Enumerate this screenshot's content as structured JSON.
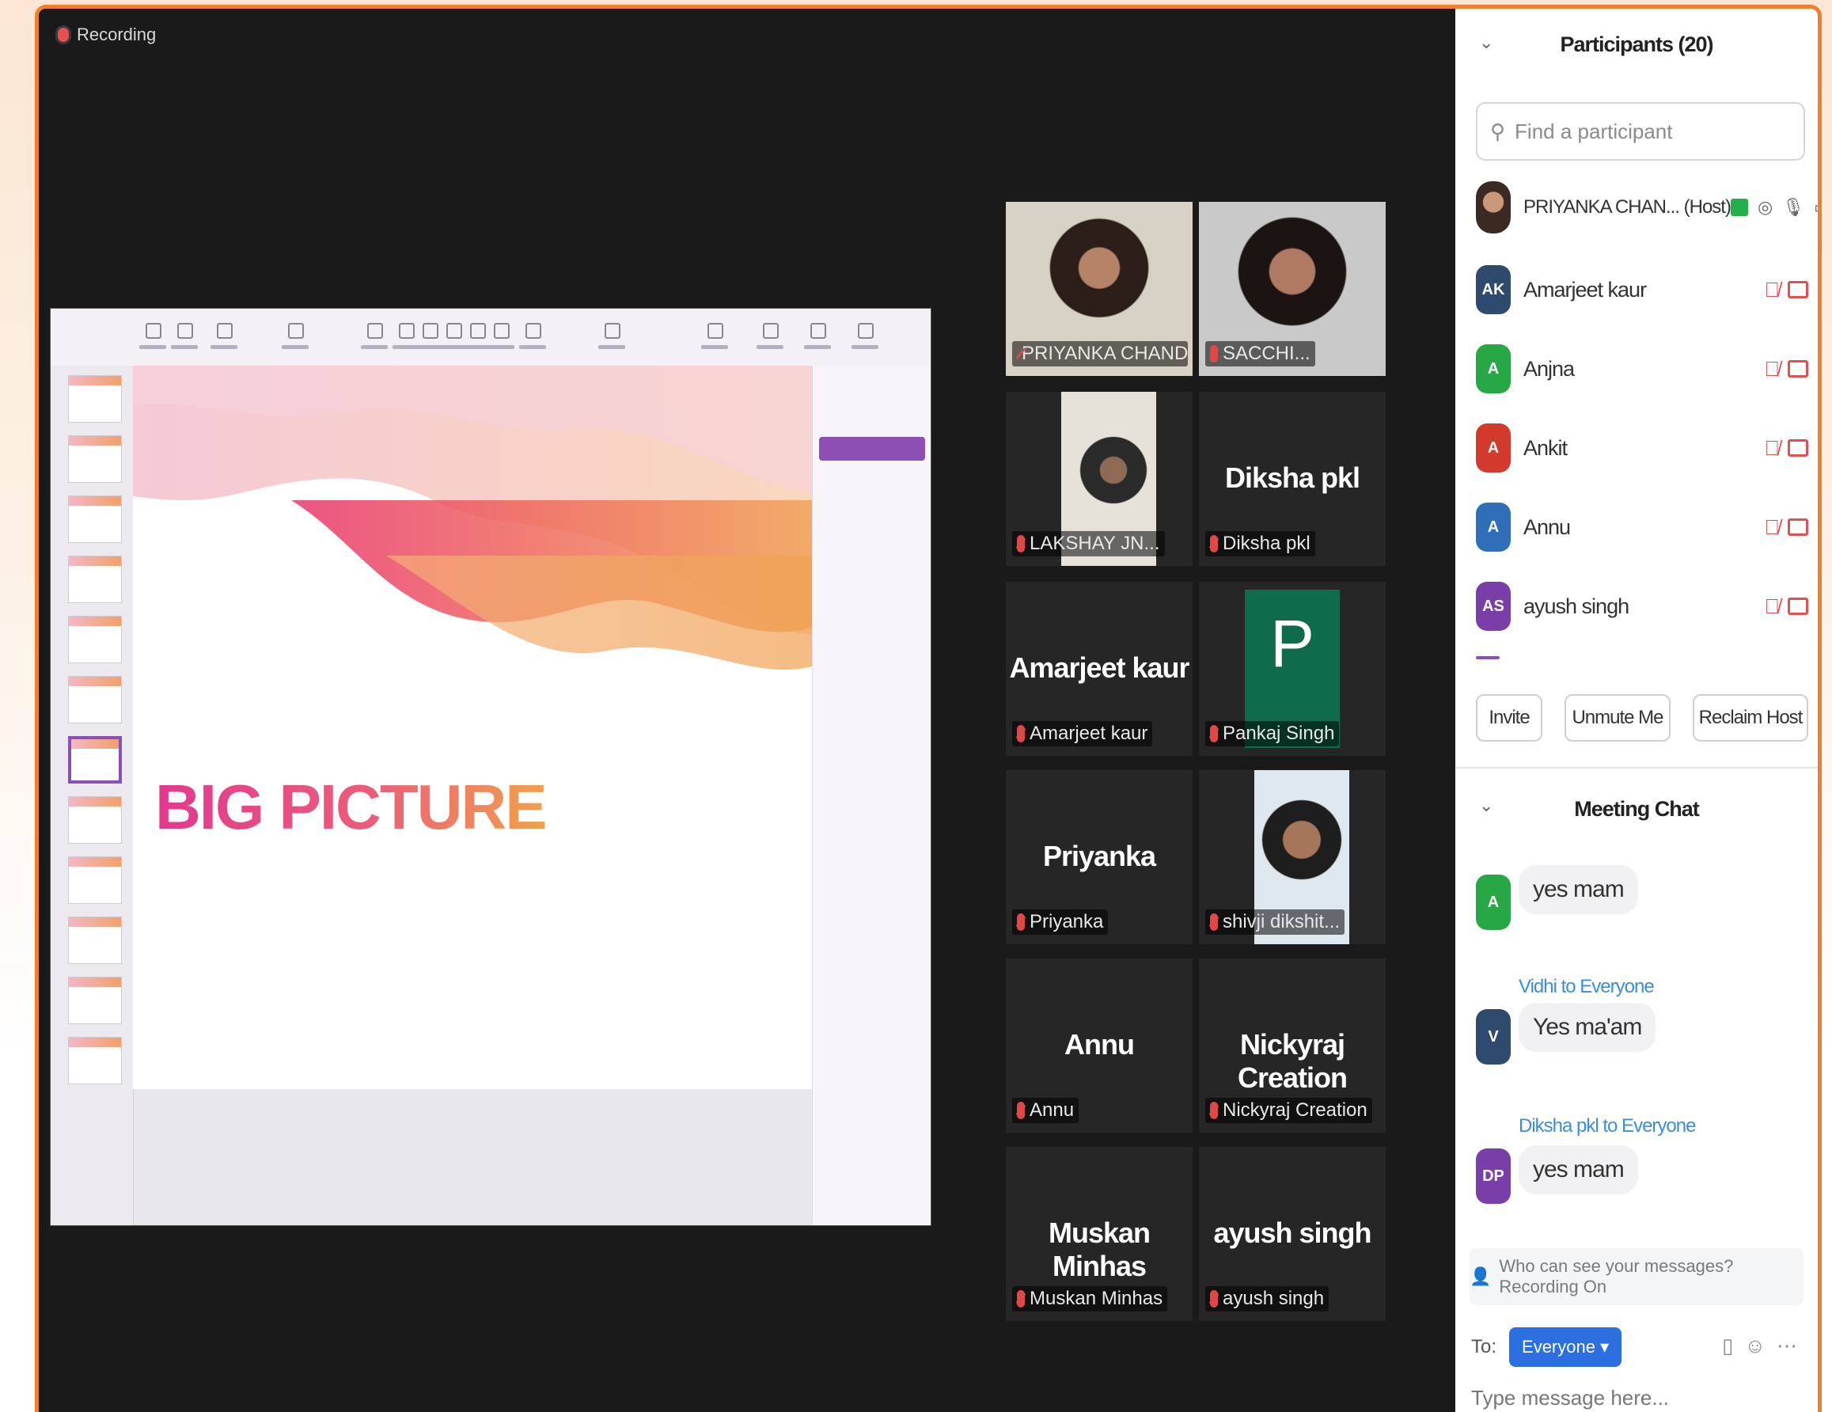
{
  "recording": {
    "label": "Recording"
  },
  "presentation": {
    "title": "BIG PICTURE",
    "colors": {
      "pink": "#e2388f",
      "orange": "#f0a24c",
      "accent": "#8c4fb4"
    }
  },
  "gallery": [
    {
      "name": "PRIYANKA CHANDIA",
      "display": "",
      "type": "video",
      "active": true
    },
    {
      "name": "SACCHI...",
      "display": "",
      "type": "video"
    },
    {
      "name": "LAKSHAY JN...",
      "display": "",
      "type": "video"
    },
    {
      "name": "Diksha pkl",
      "display": "Diksha pkl",
      "type": "name"
    },
    {
      "name": "Amarjeet kaur",
      "display": "Amarjeet kaur",
      "type": "name"
    },
    {
      "name": "Pankaj Singh",
      "display": "P",
      "type": "avatar"
    },
    {
      "name": "Priyanka",
      "display": "Priyanka",
      "type": "name"
    },
    {
      "name": "shivji dikshit...",
      "display": "",
      "type": "video"
    },
    {
      "name": "Annu",
      "display": "Annu",
      "type": "name"
    },
    {
      "name": "Nickyraj Creation",
      "display": "Nickyraj Creation",
      "type": "name"
    },
    {
      "name": "Muskan Minhas",
      "display": "Muskan Minhas",
      "type": "name"
    },
    {
      "name": "ayush singh",
      "display": "ayush singh",
      "type": "name"
    }
  ],
  "participants": {
    "title": "Participants (20)",
    "search_placeholder": "Find a participant",
    "host": {
      "name": "PRIYANKA CHAN...",
      "role": "(Host)"
    },
    "list": [
      {
        "initials": "AK",
        "name": "Amarjeet kaur",
        "color": "#2e4b6e"
      },
      {
        "initials": "A",
        "name": "Anjna",
        "color": "#27a844"
      },
      {
        "initials": "A",
        "name": "Ankit",
        "color": "#d23a2c"
      },
      {
        "initials": "A",
        "name": "Annu",
        "color": "#2f6fb8"
      },
      {
        "initials": "AS",
        "name": "ayush singh",
        "color": "#7a3ea8"
      }
    ],
    "buttons": {
      "invite": "Invite",
      "unmute": "Unmute Me",
      "reclaim": "Reclaim Host"
    }
  },
  "chat": {
    "title": "Meeting Chat",
    "messages": [
      {
        "initials": "A",
        "color": "#27a844",
        "sender": "",
        "text": "yes mam"
      },
      {
        "initials": "V",
        "color": "#2e4b6e",
        "sender": "Vidhi to Everyone",
        "text": "Yes ma'am"
      },
      {
        "initials": "DP",
        "color": "#7a3ea8",
        "sender": "Diksha pkl to Everyone",
        "text": "yes mam"
      }
    ],
    "notice": "Who can see your messages? Recording On",
    "to_label": "To:",
    "to_value": "Everyone ▾",
    "placeholder": "Type message here..."
  }
}
